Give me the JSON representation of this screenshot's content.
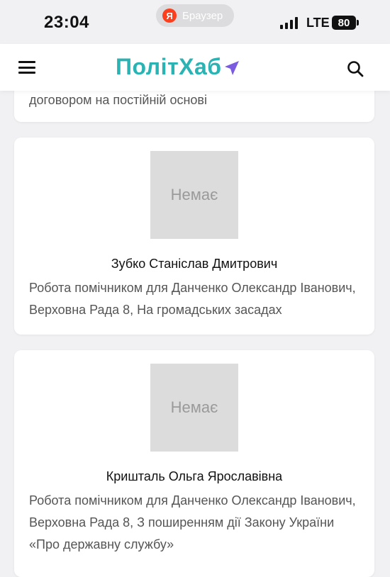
{
  "status_bar": {
    "time": "23:04",
    "browser_label": "Браузер",
    "browser_logo": "Я",
    "network": "LTE",
    "battery": "80"
  },
  "header": {
    "logo_text": "ПолітХаб",
    "menu_icon": "hamburger-menu-icon",
    "search_icon": "search-icon",
    "accent_color": "#2bb3b3",
    "logo_arrow_color": "#7b5ce0"
  },
  "cards": [
    {
      "description_tail": "договором на постійній основі"
    },
    {
      "photo_placeholder": "Немає",
      "name": "Зубко Станіслав Дмитрович",
      "description": "Робота помічником для Данченко Олександр Іванович, Верховна Рада 8, На громадських засадах"
    },
    {
      "photo_placeholder": "Немає",
      "name": "Кришталь Ольга Ярославівна",
      "description": "Робота помічником для Данченко Олександр Іванович, Верховна Рада 8, З поширенням дії Закону України «Про державну службу»"
    }
  ]
}
